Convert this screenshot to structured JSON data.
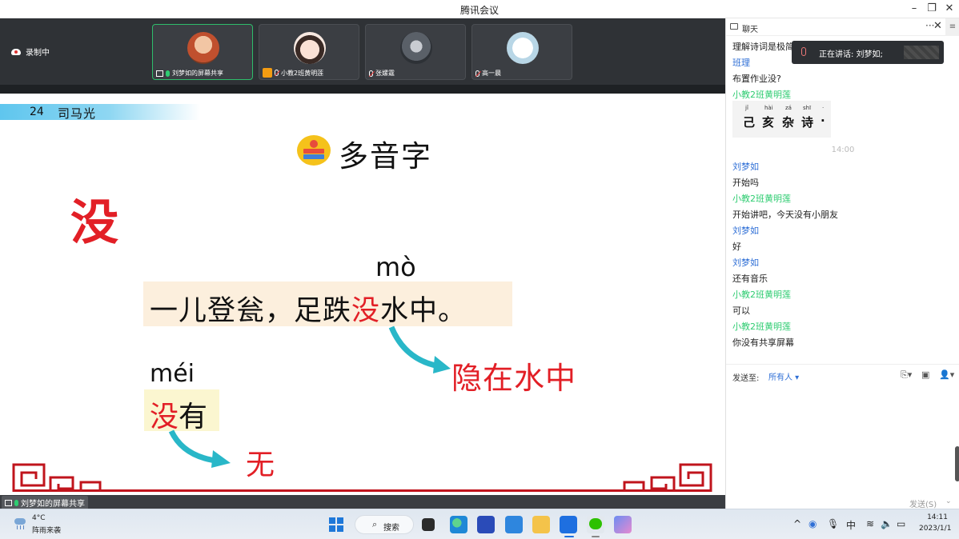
{
  "window": {
    "title": "腾讯会议"
  },
  "recording": {
    "label": "录制中"
  },
  "participants": [
    {
      "name": "刘梦如的屏幕共享",
      "active": true,
      "color": "#d9663c"
    },
    {
      "name": "小教2班黄明莲",
      "active": false,
      "color": "#f4d6c8"
    },
    {
      "name": "张嫘霆",
      "active": false,
      "color": "#8a9098"
    },
    {
      "name": "高一晨",
      "active": false,
      "color": "#e9f0f5"
    }
  ],
  "slide": {
    "lesson_number": "24",
    "lesson_title": "司马光",
    "heading": "多音字",
    "main_char": "没",
    "pinyin_mo": "mò",
    "sentence_before": "一儿登瓮，足跌",
    "sentence_char": "没",
    "sentence_after": "水中。",
    "meaning_mo": "隐在水中",
    "pinyin_mei": "méi",
    "word_char": "没",
    "word_rest": "有",
    "meaning_mei": "无"
  },
  "share_status": "刘梦如的屏幕共享",
  "chat": {
    "title": "聊天",
    "speaking_label": "正在讲话: 刘梦如;",
    "messages_top": [
      {
        "text": "理解诗词是极简"
      },
      {
        "sender": "班理"
      },
      {
        "text": "布置作业没?"
      },
      {
        "sender": "小教2班黄明莲"
      }
    ],
    "image_card": {
      "pinyin": [
        "jǐ",
        "hài",
        "zá",
        "shī",
        "·"
      ],
      "chars": [
        "己",
        "亥",
        "杂",
        "诗",
        "·"
      ]
    },
    "time": "14:00",
    "messages": [
      {
        "sender": "刘梦如",
        "text": "开始吗"
      },
      {
        "sender": "小教2班黄明莲",
        "text": "开始讲吧，今天没有小朋友"
      },
      {
        "sender": "刘梦如",
        "text": "好"
      },
      {
        "sender": "刘梦如",
        "text": "还有音乐"
      },
      {
        "sender": "小教2班黄明莲",
        "text": "可以"
      },
      {
        "sender": "小教2班黄明莲",
        "text": "你没有共享屏幕"
      }
    ],
    "send_to_label": "发送至:",
    "send_to_target": "所有人",
    "send_button": "发送(S)"
  },
  "taskbar": {
    "temperature": "4°C",
    "weather": "阵雨来袭",
    "search_label": "搜索",
    "ime": "中",
    "time": "14:11",
    "date": "2023/1/1"
  }
}
